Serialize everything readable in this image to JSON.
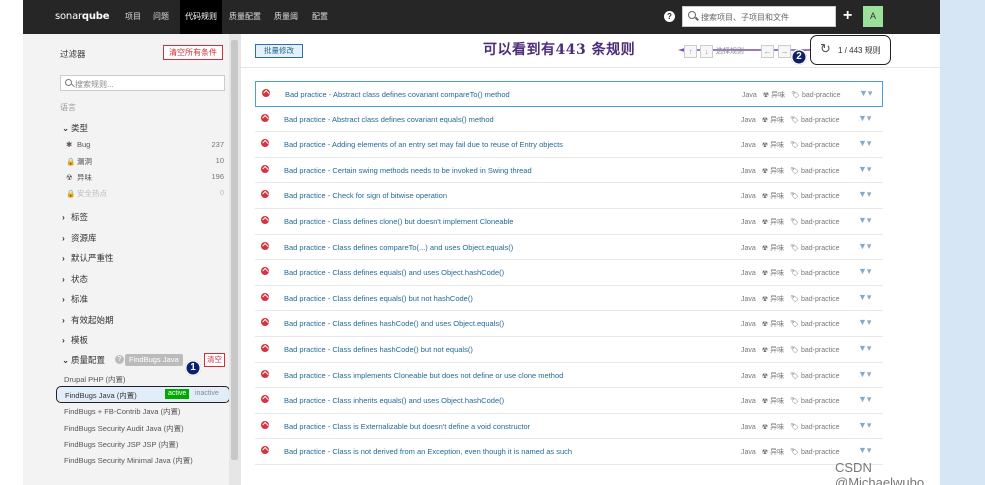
{
  "nav": {
    "logo_pre": "sonar",
    "logo_post": "qube",
    "items": [
      "项目",
      "问题",
      "代码规则",
      "质量配置",
      "质量阈",
      "配置"
    ],
    "active_index": 2,
    "search_placeholder": "搜索项目、子项目和文件",
    "help_icon": "?",
    "plus_icon": "+",
    "avatar_letter": "A"
  },
  "sidebar": {
    "title": "过滤器",
    "clear_all": "清空所有条件",
    "search_placeholder": "搜索规则...",
    "language_label": "语言",
    "type_facet": "类型",
    "types": [
      {
        "icon": "bug-icon",
        "glyph": "✱",
        "label": "Bug",
        "count": "237",
        "disabled": false
      },
      {
        "icon": "lock-icon",
        "glyph": "🔒",
        "label": "漏洞",
        "count": "10",
        "disabled": false
      },
      {
        "icon": "code-smell-icon",
        "glyph": "☢",
        "label": "异味",
        "count": "196",
        "disabled": false
      },
      {
        "icon": "hotspot-icon",
        "glyph": "🔒",
        "label": "安全热点",
        "count": "0",
        "disabled": true
      }
    ],
    "facets": [
      "标签",
      "资源库",
      "默认严重性",
      "状态",
      "标准",
      "有效起始期",
      "模板"
    ],
    "quality_profile": {
      "label": "质量配置",
      "badge": "FindBugs Java",
      "clear": "清空",
      "items_before": [
        "Drupal PHP (内置)"
      ],
      "selected": {
        "name": "FindBugs Java (内置)",
        "active": "active",
        "inactive": "inactive"
      },
      "items_after": [
        "FindBugs + FB-Contrib Java (内置)",
        "FindBugs Security Audit Java (内置)",
        "FindBugs Security JSP JSP (内置)",
        "FindBugs Security Minimal Java (内置)"
      ]
    }
  },
  "main": {
    "bulk_change": "批量修改",
    "annotation": "可以看到有443 条规则",
    "select_rule": "选择规则",
    "counter": "1 / 443 规则",
    "marker_1": "1",
    "marker_2": "2",
    "nav_up": "↑",
    "nav_down": "↓",
    "nav_left": "←",
    "nav_right": "→"
  },
  "rules": [
    {
      "title": "Bad practice - Abstract class defines covariant compareTo() method",
      "lang": "Java",
      "type": "异味",
      "tag": "bad-practice"
    },
    {
      "title": "Bad practice - Abstract class defines covariant equals() method",
      "lang": "Java",
      "type": "异味",
      "tag": "bad-practice"
    },
    {
      "title": "Bad practice - Adding elements of an entry set may fail due to reuse of Entry objects",
      "lang": "Java",
      "type": "异味",
      "tag": "bad-practice"
    },
    {
      "title": "Bad practice - Certain swing methods needs to be invoked in Swing thread",
      "lang": "Java",
      "type": "异味",
      "tag": "bad-practice"
    },
    {
      "title": "Bad practice - Check for sign of bitwise operation",
      "lang": "Java",
      "type": "异味",
      "tag": "bad-practice"
    },
    {
      "title": "Bad practice - Class defines clone() but doesn't implement Cloneable",
      "lang": "Java",
      "type": "异味",
      "tag": "bad-practice"
    },
    {
      "title": "Bad practice - Class defines compareTo(...) and uses Object.equals()",
      "lang": "Java",
      "type": "异味",
      "tag": "bad-practice"
    },
    {
      "title": "Bad practice - Class defines equals() and uses Object.hashCode()",
      "lang": "Java",
      "type": "异味",
      "tag": "bad-practice"
    },
    {
      "title": "Bad practice - Class defines equals() but not hashCode()",
      "lang": "Java",
      "type": "异味",
      "tag": "bad-practice"
    },
    {
      "title": "Bad practice - Class defines hashCode() and uses Object.equals()",
      "lang": "Java",
      "type": "异味",
      "tag": "bad-practice"
    },
    {
      "title": "Bad practice - Class defines hashCode() but not equals()",
      "lang": "Java",
      "type": "异味",
      "tag": "bad-practice"
    },
    {
      "title": "Bad practice - Class implements Cloneable but does not define or use clone method",
      "lang": "Java",
      "type": "异味",
      "tag": "bad-practice"
    },
    {
      "title": "Bad practice - Class inherits equals() and uses Object.hashCode()",
      "lang": "Java",
      "type": "异味",
      "tag": "bad-practice"
    },
    {
      "title": "Bad practice - Class is Externalizable but doesn't define a void constructor",
      "lang": "Java",
      "type": "异味",
      "tag": "bad-practice"
    },
    {
      "title": "Bad practice - Class is not derived from an Exception, even though it is named as such",
      "lang": "Java",
      "type": "异味",
      "tag": "bad-practice"
    }
  ],
  "watermark": "CSDN @Michaelwubo"
}
